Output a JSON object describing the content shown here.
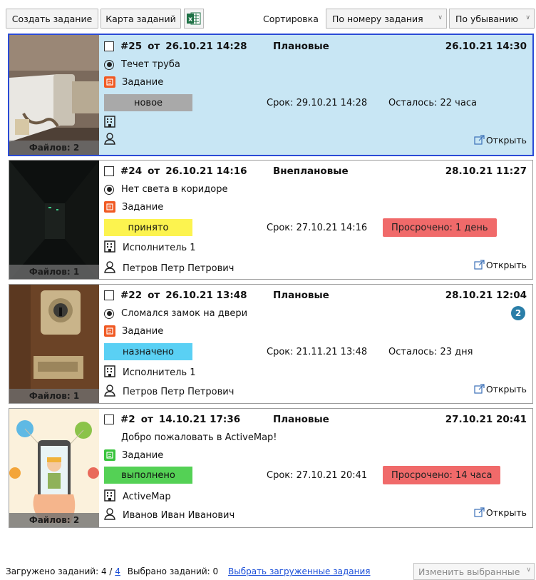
{
  "toolbar": {
    "create_label": "Создать задание",
    "map_label": "Карта заданий",
    "excel_icon": "excel-icon",
    "sort_label": "Сортировка",
    "sort_by": "По номеру задания",
    "sort_order": "По убыванию"
  },
  "tasks": [
    {
      "number": "#25",
      "from": "от",
      "created": "26.10.21 14:28",
      "type": "Плановые",
      "updated": "26.10.21 14:30",
      "title": "Течет труба",
      "kind": "Задание",
      "status": "новое",
      "status_color": "#a9a9a9",
      "deadline": "Срок: 29.10.21 14:28",
      "remaining": "Осталось: 22 часа",
      "overdue": "",
      "org": "",
      "person": "",
      "files": "Файлов: 2",
      "open": "Открыть",
      "badge": "",
      "selected": true
    },
    {
      "number": "#24",
      "from": "от",
      "created": "26.10.21 14:16",
      "type": "Внеплановые",
      "updated": "28.10.21 11:27",
      "title": "Нет света в коридоре",
      "kind": "Задание",
      "status": "принято",
      "status_color": "#fcf34f",
      "deadline": "Срок: 27.10.21 14:16",
      "remaining": "",
      "overdue": "Просрочено: 1 день",
      "org": "Исполнитель 1",
      "person": "Петров Петр Петрович",
      "files": "Файлов: 1",
      "open": "Открыть",
      "badge": ""
    },
    {
      "number": "#22",
      "from": "от",
      "created": "26.10.21 13:48",
      "type": "Плановые",
      "updated": "28.10.21 12:04",
      "title": "Сломался замок на двери",
      "kind": "Задание",
      "status": "назначено",
      "status_color": "#5ad0f4",
      "deadline": "Срок: 21.11.21 13:48",
      "remaining": "Осталось: 23 дня",
      "overdue": "",
      "org": "Исполнитель 1",
      "person": "Петров Петр Петрович",
      "files": "Файлов: 1",
      "open": "Открыть",
      "badge": "2"
    },
    {
      "number": "#2",
      "from": "от",
      "created": "14.10.21 17:36",
      "type": "Плановые",
      "updated": "27.10.21 20:41",
      "title": "Добро пожаловать в ActiveMap!",
      "kind": "Задание",
      "status": "выполнено",
      "status_color": "#54d155",
      "deadline": "Срок: 27.10.21 20:41",
      "remaining": "",
      "overdue": "Просрочено: 14 часа",
      "org": "ActiveMap",
      "person": "Иванов Иван Иванович",
      "files": "Файлов: 2",
      "open": "Открыть",
      "badge": ""
    }
  ],
  "footer": {
    "loaded_prefix": "Загружено заданий: 4 /",
    "loaded_link": "4",
    "selected_text": "Выбрано заданий: 0",
    "select_loaded_link": "Выбрать загруженные задания",
    "change_selected": "Изменить выбранные"
  }
}
